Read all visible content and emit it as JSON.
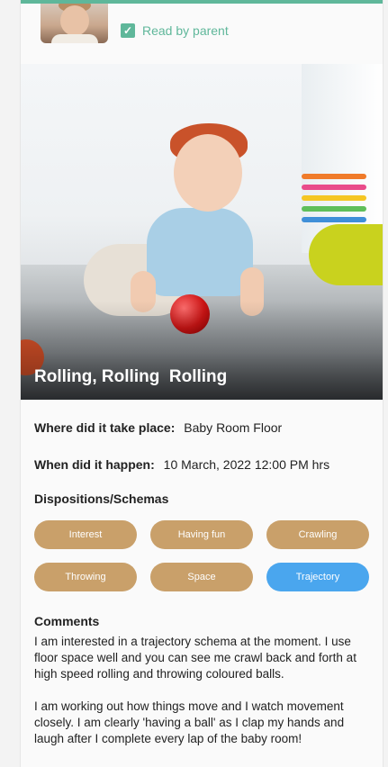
{
  "header": {
    "read_status": "Read by parent",
    "read_checked": true,
    "accent": "#5fb79a"
  },
  "observation": {
    "title": "Rolling, Rolling  Rolling",
    "where_label": "Where did it take place:",
    "where_value": "Baby Room Floor",
    "when_label": "When did it happen:",
    "when_value": "10 March, 2022 12:00 PM hrs"
  },
  "dispositions": {
    "title": "Dispositions/Schemas",
    "chips": [
      {
        "label": "Interest",
        "active": false
      },
      {
        "label": "Having fun",
        "active": false
      },
      {
        "label": "Crawling",
        "active": false
      },
      {
        "label": "Throwing",
        "active": false
      },
      {
        "label": "Space",
        "active": false
      },
      {
        "label": "Trajectory",
        "active": true
      }
    ],
    "chip_color": "#c9a06a",
    "active_color": "#4aa6ee"
  },
  "comments": {
    "title": "Comments",
    "paragraphs": [
      "I am interested in a trajectory schema at the moment. I use floor space well and you can see me crawl back and forth at high speed rolling and throwing coloured balls.",
      "I am working out how things move and I watch movement closely.  I am clearly 'having a ball' as I clap my hands and laugh after I complete every lap of the baby room!"
    ]
  }
}
